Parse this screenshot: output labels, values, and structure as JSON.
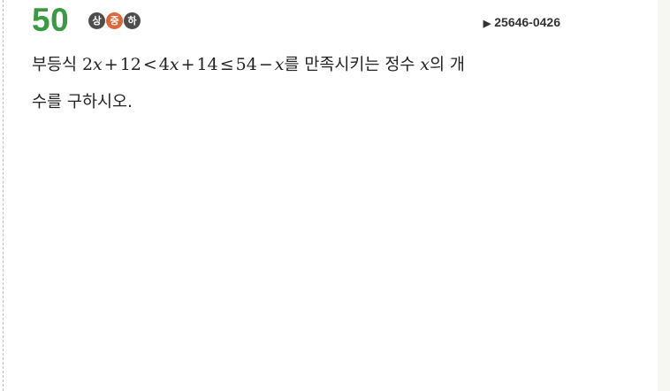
{
  "problem": {
    "number": "50",
    "difficulty": [
      {
        "label": "상",
        "color": "#4d4d4d"
      },
      {
        "label": "중",
        "color": "#e0663a"
      },
      {
        "label": "하",
        "color": "#4d4d4d"
      }
    ],
    "selected_difficulty": "중",
    "code_marker": "▶",
    "code": "25646-0426"
  },
  "question": {
    "line1_lead": "부등식 ",
    "inequality": "2x+12<4x+14≤54−x",
    "line1_after_math": "를 만족시키는 정수 ",
    "variable": "x",
    "line1_tail": "의 개",
    "line2": "수를 구하시오."
  }
}
